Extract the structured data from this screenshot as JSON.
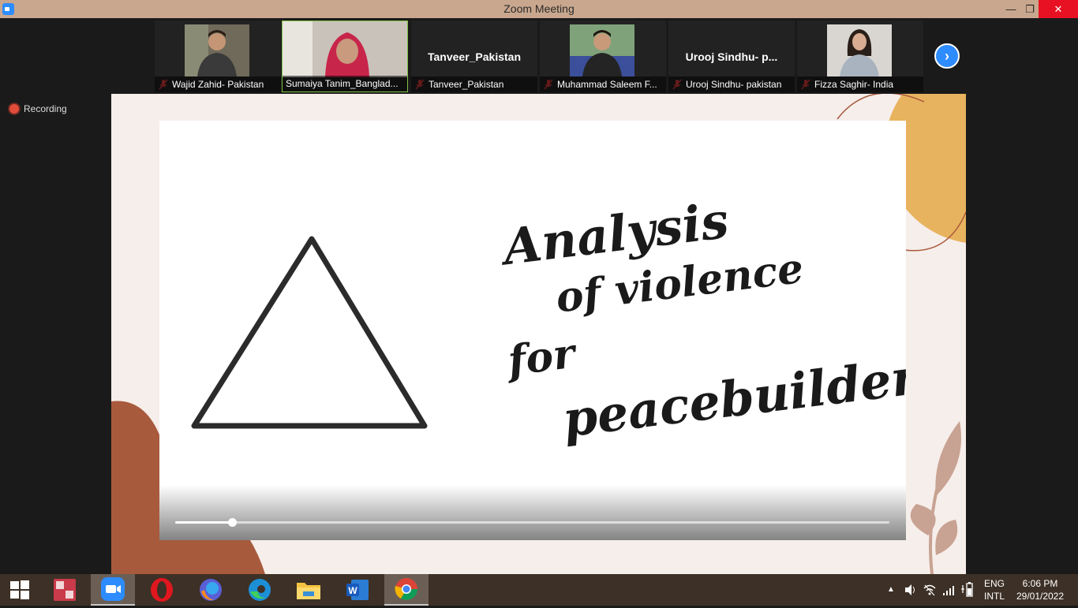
{
  "window": {
    "title": "Zoom Meeting"
  },
  "participants": [
    {
      "name": "Wajid Zahid- Pakistan",
      "has_video": true,
      "muted": true,
      "active": false
    },
    {
      "name": "Sumaiya Tanim_Banglad...",
      "has_video": true,
      "muted": false,
      "active": true
    },
    {
      "name": "Tanveer_Pakistan",
      "display_name": "Tanveer_Pakistan",
      "has_video": false,
      "muted": true,
      "active": false
    },
    {
      "name": "Muhammad Saleem F...",
      "has_video": true,
      "muted": true,
      "active": false
    },
    {
      "name": "Urooj Sindhu- pakistan",
      "display_name": "Urooj  Sindhu-  p...",
      "has_video": false,
      "muted": true,
      "active": false
    },
    {
      "name": "Fizza Saghir- India",
      "has_video": true,
      "muted": true,
      "active": false
    }
  ],
  "recording": {
    "label": "Recording"
  },
  "slide": {
    "title_lines": [
      "Analysis",
      "of violence",
      "for",
      "peacebuilders"
    ],
    "progress": 0.08
  },
  "tray": {
    "language_top": "ENG",
    "language_bottom": "INTL",
    "time": "6:06 PM",
    "date": "29/01/2022"
  },
  "colors": {
    "zoom_blue": "#2d8cff",
    "title_bar": "#c9a78e",
    "taskbar": "#3d3026",
    "active_border": "#7ec242"
  }
}
